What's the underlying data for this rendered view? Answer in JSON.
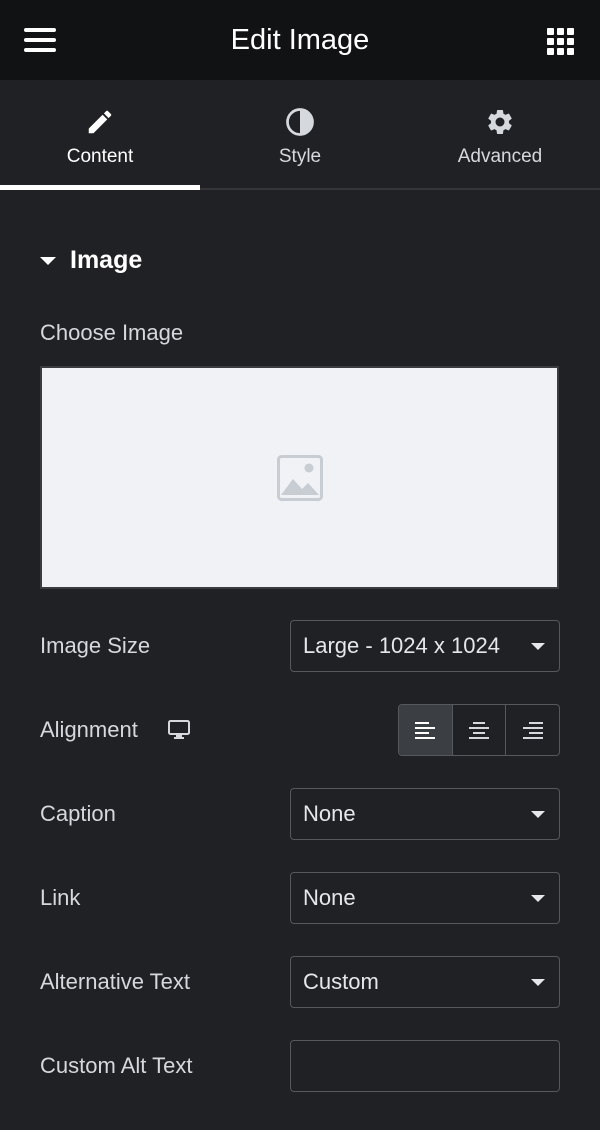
{
  "header": {
    "title": "Edit Image",
    "left_icon": "hamburger-menu-icon",
    "right_icon": "apps-grid-icon"
  },
  "tabs": [
    {
      "label": "Content",
      "icon": "pencil-icon",
      "active": true
    },
    {
      "label": "Style",
      "icon": "half-circle-contrast-icon",
      "active": false
    },
    {
      "label": "Advanced",
      "icon": "gear-icon",
      "active": false
    }
  ],
  "section": {
    "title": "Image",
    "expanded": true
  },
  "choose_image": {
    "label": "Choose Image",
    "placeholder_icon": "image-placeholder-icon"
  },
  "fields": {
    "image_size": {
      "label": "Image Size",
      "value": "Large - 1024 x 1024"
    },
    "alignment": {
      "label": "Alignment",
      "device_icon": "desktop-monitor-icon",
      "options": [
        "left",
        "center",
        "right"
      ],
      "selected": "left"
    },
    "caption": {
      "label": "Caption",
      "value": "None"
    },
    "link": {
      "label": "Link",
      "value": "None"
    },
    "alt_text": {
      "label": "Alternative Text",
      "value": "Custom"
    },
    "custom_alt": {
      "label": "Custom Alt Text",
      "value": ""
    }
  },
  "colors": {
    "background": "#1f2124",
    "header_bg": "#111214",
    "text": "#d5d8dc",
    "active": "#ffffff",
    "border": "#55585c"
  }
}
